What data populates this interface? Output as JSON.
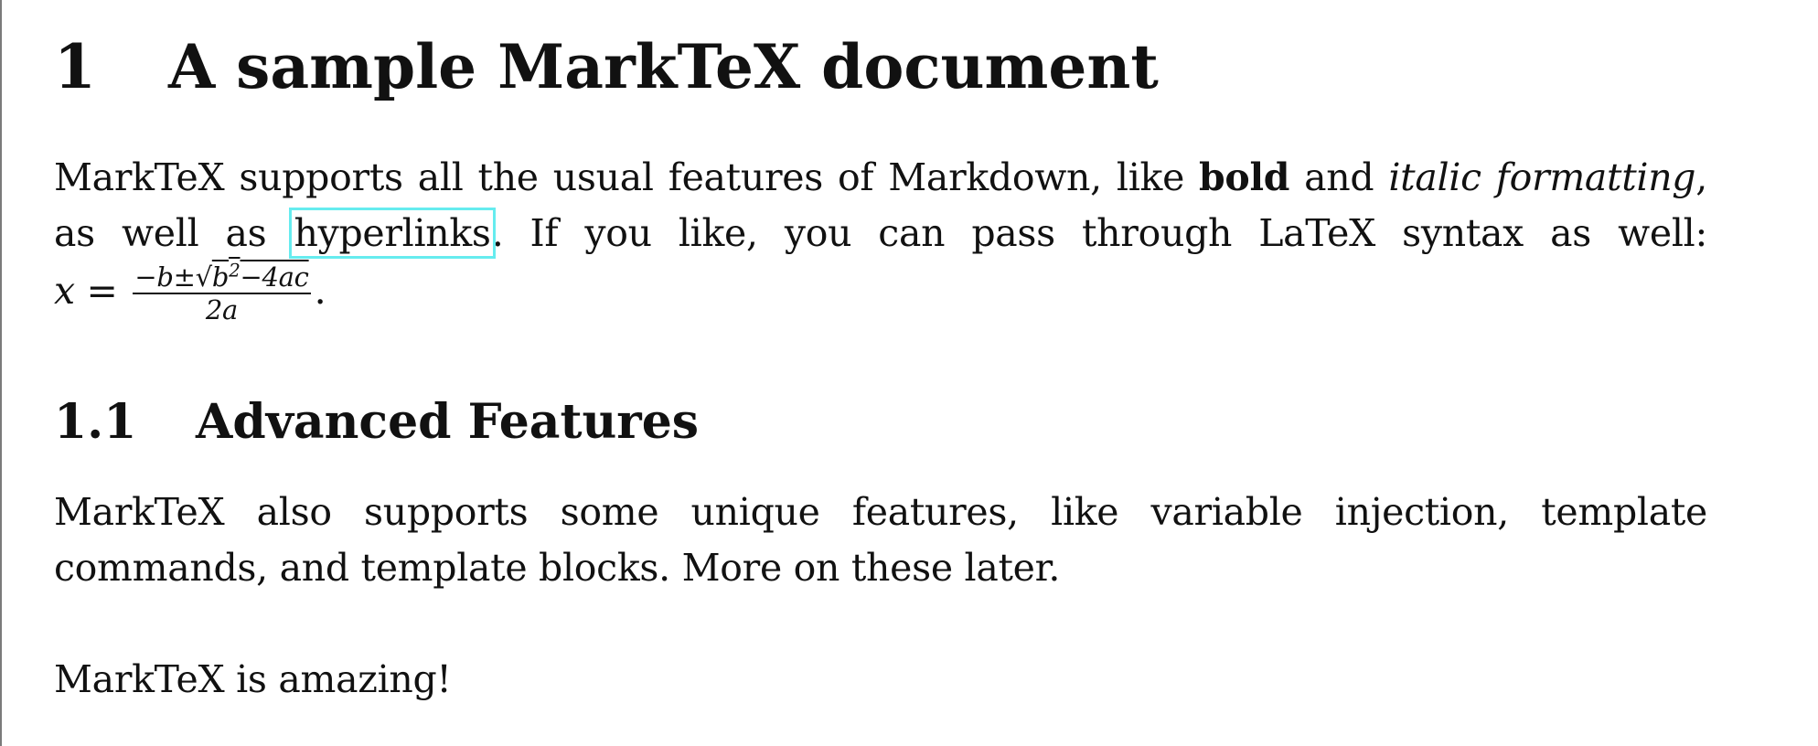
{
  "section1": {
    "number": "1",
    "title": "A sample MarkTeX document"
  },
  "para1": {
    "t1": "MarkTeX supports all the usual features of Markdown, like ",
    "bold": "bold",
    "t2": " and ",
    "italic": "italic formatting",
    "t3": ", as well as ",
    "link": "hyperlinks",
    "t4": ". If you like, you can pass through LaTeX syntax as well: ",
    "formula": {
      "lhs": "x",
      "eq": " = ",
      "num_pre": "−b±√",
      "num_rad": "b",
      "num_exp": "2",
      "num_post": "−4ac",
      "den": "2a",
      "end": "."
    }
  },
  "section2": {
    "number": "1.1",
    "title": "Advanced Features"
  },
  "para2": "MarkTeX also supports some unique features, like variable injection, template commands, and template blocks. More on these later.",
  "para3": "MarkTeX is amazing!"
}
